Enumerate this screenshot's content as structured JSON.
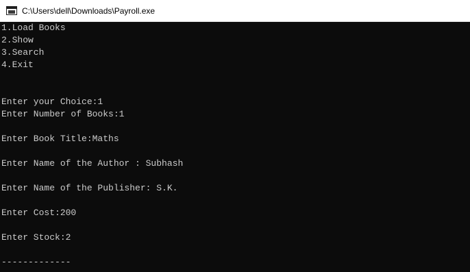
{
  "window": {
    "title": "C:\\Users\\dell\\Downloads\\Payroll.exe",
    "icon": "console-app-icon"
  },
  "console": {
    "colors": {
      "background": "#0c0c0c",
      "text": "#cccccc"
    },
    "lines": [
      "1.Load Books",
      "2.Show",
      "3.Search",
      "4.Exit",
      "",
      "",
      "Enter your Choice:1",
      "Enter Number of Books:1",
      "",
      "Enter Book Title:Maths",
      "",
      "Enter Name of the Author : Subhash",
      "",
      "Enter Name of the Publisher: S.K.",
      "",
      "Enter Cost:200",
      "",
      "Enter Stock:2",
      "",
      "-------------"
    ]
  }
}
